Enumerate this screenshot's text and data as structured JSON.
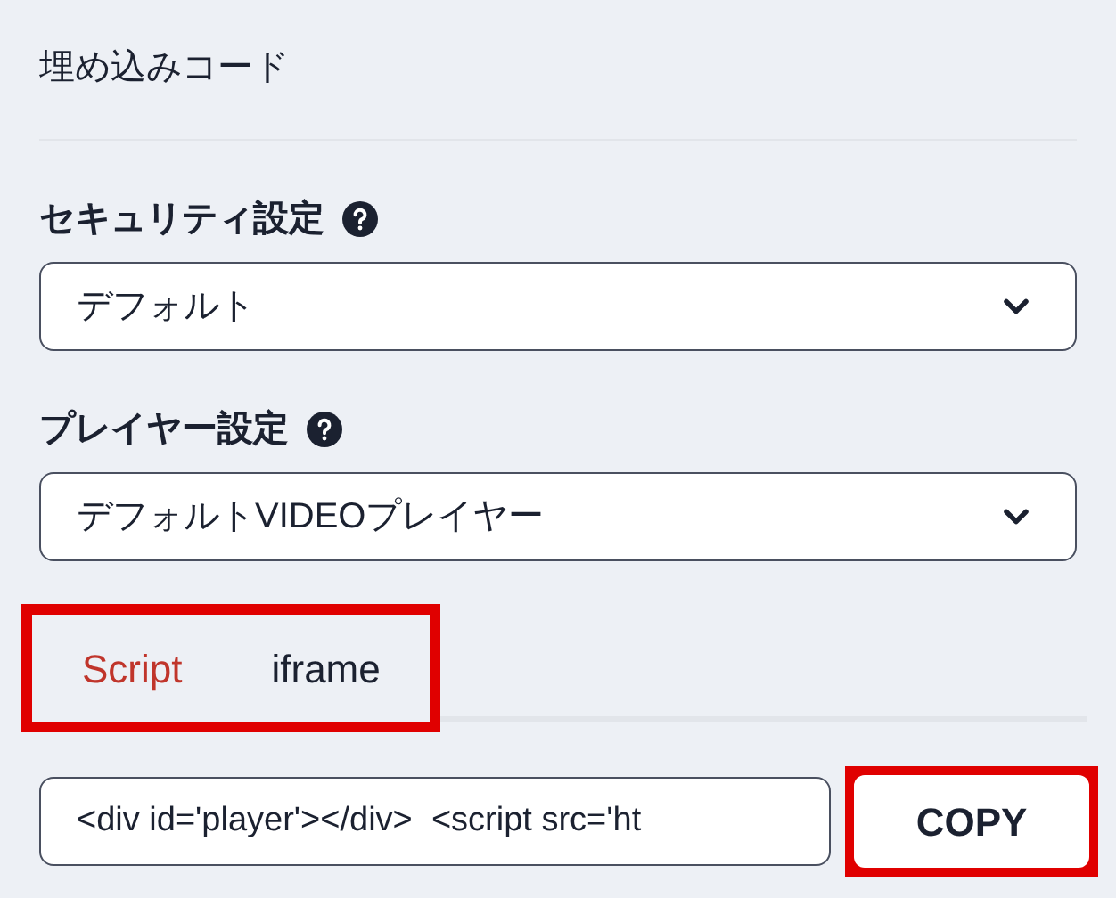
{
  "section_title": "埋め込みコード",
  "settings": [
    {
      "label": "セキュリティ設定",
      "value": "デフォルト"
    },
    {
      "label": "プレイヤー設定",
      "value": "デフォルトVIDEOプレイヤー"
    }
  ],
  "tabs": {
    "highlighted": true,
    "items": [
      {
        "label": "Script",
        "selected": true
      },
      {
        "label": "iframe",
        "selected": false
      }
    ]
  },
  "embed_code": {
    "value": "<div id='player'></div>  <script src='ht"
  },
  "copy_button": {
    "label": "COPY",
    "highlighted": true
  }
}
